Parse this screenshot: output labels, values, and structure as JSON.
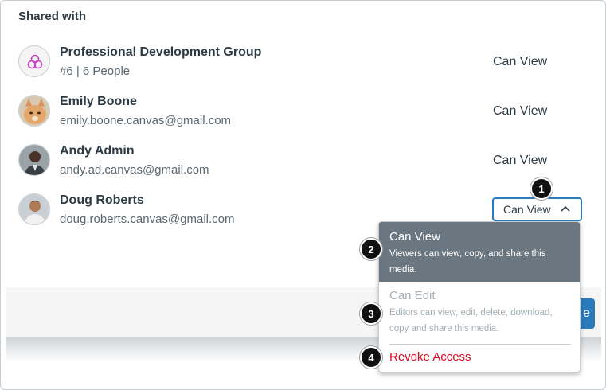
{
  "section": {
    "title": "Shared with"
  },
  "shares": [
    {
      "name": "Professional Development Group",
      "detail": "#6 | 6 People",
      "permission": "Can View",
      "avatar": "group-icon"
    },
    {
      "name": "Emily Boone",
      "detail": "emily.boone.canvas@gmail.com",
      "permission": "Can View",
      "avatar": "cat-photo"
    },
    {
      "name": "Andy Admin",
      "detail": "andy.ad.canvas@gmail.com",
      "permission": "Can View",
      "avatar": "person-photo"
    },
    {
      "name": "Doug Roberts",
      "detail": "doug.roberts.canvas@gmail.com",
      "permission": "Can View",
      "avatar": "person-photo"
    }
  ],
  "permission_menu": {
    "items": [
      {
        "label": "Can View",
        "description": "Viewers can view, copy, and share this media.",
        "state": "selected"
      },
      {
        "label": "Can Edit",
        "description": "Editors can view, edit, delete, download, copy and share this media.",
        "state": "disabled"
      },
      {
        "label": "Revoke Access",
        "state": "danger"
      }
    ]
  },
  "footer": {
    "done_label": "e"
  },
  "callouts": [
    "1",
    "2",
    "3",
    "4"
  ],
  "colors": {
    "accent": "#2b7abc",
    "selected_bg": "#6b7780",
    "danger": "#e0061f",
    "text": "#2d3b45"
  }
}
